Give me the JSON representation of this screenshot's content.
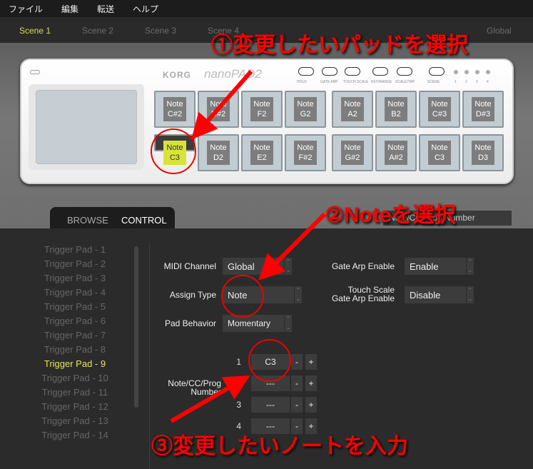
{
  "menu": [
    "ファイル",
    "編集",
    "転送",
    "ヘルプ"
  ],
  "scenes": [
    "Scene 1",
    "Scene 2",
    "Scene 3",
    "Scene 4",
    "Global"
  ],
  "device": {
    "brand": "KORG",
    "model": "nanoPAD2",
    "buttons": [
      "HOLD",
      "GATE ARP",
      "TOUCH SCALE",
      "KEY/RANGE",
      "SCALE/TAP",
      "SCENE"
    ],
    "scene_leds": [
      "1",
      "2",
      "3",
      "4"
    ]
  },
  "pads_top": [
    [
      "Note",
      "C#2"
    ],
    [
      "Note",
      "D#2"
    ],
    [
      "Note",
      "F2"
    ],
    [
      "Note",
      "G2"
    ],
    [
      "Note",
      "A2"
    ],
    [
      "Note",
      "B2"
    ],
    [
      "Note",
      "C#3"
    ],
    [
      "Note",
      "D#3"
    ]
  ],
  "pads_bottom": [
    [
      "Note",
      "C3"
    ],
    [
      "Note",
      "D2"
    ],
    [
      "Note",
      "E2"
    ],
    [
      "Note",
      "F#2"
    ],
    [
      "Note",
      "G#2"
    ],
    [
      "Note",
      "A#2"
    ],
    [
      "Note",
      "C3"
    ],
    [
      "Note",
      "D3"
    ]
  ],
  "tabs": {
    "browse": "BROWSE",
    "control": "CONTROL"
  },
  "view_select": "Note/CC/Prog Number",
  "trigger_pads": [
    "Trigger Pad - 1",
    "Trigger Pad - 2",
    "Trigger Pad - 3",
    "Trigger Pad - 4",
    "Trigger Pad - 5",
    "Trigger Pad - 6",
    "Trigger Pad - 7",
    "Trigger Pad - 8",
    "Trigger Pad - 9",
    "Trigger Pad - 10",
    "Trigger Pad - 11",
    "Trigger Pad - 12",
    "Trigger Pad - 13",
    "Trigger Pad - 14"
  ],
  "form": {
    "midi_channel_label": "MIDI Channel",
    "midi_channel": "Global",
    "assign_type_label": "Assign Type",
    "assign_type": "Note",
    "pad_behavior_label": "Pad Behavior",
    "pad_behavior": "Momentary",
    "gate_arp_label": "Gate Arp Enable",
    "gate_arp": "Enable",
    "touch_scale_label1": "Touch Scale",
    "touch_scale_label2": "Gate Arp Enable",
    "touch_scale": "Disable",
    "note_label1": "Note/CC/Prog",
    "note_label2": "Number"
  },
  "notes": [
    {
      "n": "1",
      "v": "C3"
    },
    {
      "n": "2",
      "v": "---"
    },
    {
      "n": "3",
      "v": "---"
    },
    {
      "n": "4",
      "v": "---"
    }
  ],
  "minus": "-",
  "plus": "+",
  "annotations": {
    "a1": "①変更したいパッドを選択",
    "a2": "②Noteを選択",
    "a3": "③変更したいノートを入力"
  }
}
